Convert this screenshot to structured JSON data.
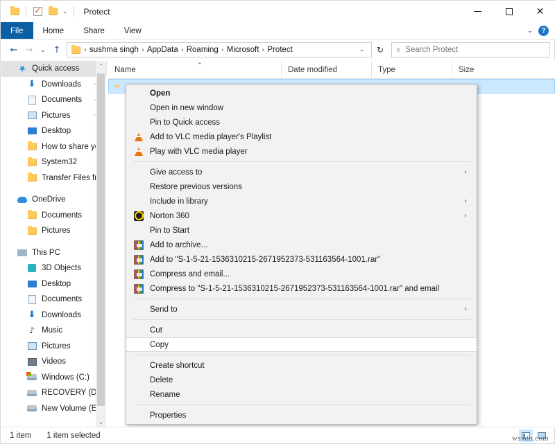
{
  "window": {
    "title": "Protect",
    "minimize_label": "Minimize",
    "maximize_label": "Maximize",
    "close_label": "Close",
    "help_label": "?",
    "ribbon_expand": "⌄"
  },
  "quick_access_toolbar": [
    {
      "name": "properties-folder",
      "icon": "folder-icon"
    },
    {
      "name": "checkbox-toggle",
      "icon": "checkbox-icon"
    },
    {
      "name": "new-folder",
      "icon": "folder-icon"
    },
    {
      "name": "customize-dropdown",
      "icon": "chevron-down-icon",
      "label": "⌄"
    }
  ],
  "ribbon": {
    "tabs": [
      {
        "label": "File",
        "active": true
      },
      {
        "label": "Home",
        "active": false
      },
      {
        "label": "Share",
        "active": false
      },
      {
        "label": "View",
        "active": false
      }
    ]
  },
  "navigation": {
    "back": "←",
    "forward": "→",
    "recent": "⌄",
    "up": "↑",
    "refresh": "↻",
    "breadcrumb": [
      "sushma singh",
      "AppData",
      "Roaming",
      "Microsoft",
      "Protect"
    ],
    "breadcrumb_separator": "›",
    "breadcrumb_caret": "⌄"
  },
  "search": {
    "placeholder": "Search Protect",
    "value": "",
    "icon": "search-icon"
  },
  "sidebar": {
    "groups": [
      {
        "header": {
          "label": "Quick access",
          "icon": "star-icon",
          "selected": true
        },
        "items": [
          {
            "label": "Downloads",
            "icon": "download-icon",
            "pinned": true
          },
          {
            "label": "Documents",
            "icon": "document-icon",
            "pinned": true
          },
          {
            "label": "Pictures",
            "icon": "picture-icon",
            "pinned": true
          },
          {
            "label": "Desktop",
            "icon": "desktop-icon",
            "pinned": false
          },
          {
            "label": "How to share yo",
            "icon": "folder-icon",
            "pinned": false
          },
          {
            "label": "System32",
            "icon": "folder-icon",
            "pinned": false
          },
          {
            "label": "Transfer Files fro",
            "icon": "folder-icon",
            "pinned": false
          }
        ]
      },
      {
        "header": {
          "label": "OneDrive",
          "icon": "cloud-icon",
          "selected": false
        },
        "items": [
          {
            "label": "Documents",
            "icon": "folder-icon",
            "pinned": false
          },
          {
            "label": "Pictures",
            "icon": "folder-icon",
            "pinned": false
          }
        ]
      },
      {
        "header": {
          "label": "This PC",
          "icon": "pc-icon",
          "selected": false
        },
        "items": [
          {
            "label": "3D Objects",
            "icon": "3d-objects-icon",
            "pinned": false
          },
          {
            "label": "Desktop",
            "icon": "desktop-icon",
            "pinned": false
          },
          {
            "label": "Documents",
            "icon": "document-icon",
            "pinned": false
          },
          {
            "label": "Downloads",
            "icon": "download-icon",
            "pinned": false
          },
          {
            "label": "Music",
            "icon": "music-icon",
            "pinned": false
          },
          {
            "label": "Pictures",
            "icon": "picture-icon",
            "pinned": false
          },
          {
            "label": "Videos",
            "icon": "video-icon",
            "pinned": false
          },
          {
            "label": "Windows (C:)",
            "icon": "windows-drive-icon",
            "pinned": false
          },
          {
            "label": "RECOVERY (D:)",
            "icon": "drive-icon",
            "pinned": false
          },
          {
            "label": "New Volume (E:)",
            "icon": "drive-icon",
            "pinned": false
          }
        ]
      }
    ],
    "scroll_up": "⌃",
    "scroll_down": "⌄"
  },
  "columns": [
    {
      "label": "Name",
      "sorted": true,
      "sort_caret": "⌃"
    },
    {
      "label": "Date modified",
      "sorted": false
    },
    {
      "label": "Type",
      "sorted": false
    },
    {
      "label": "Size",
      "sorted": false
    }
  ],
  "file_rows": [
    {
      "name": "",
      "icon": "folder-icon",
      "selected": true
    }
  ],
  "context_menu": {
    "items": [
      {
        "label": "Open",
        "icon": null,
        "bold": true,
        "submenu": false,
        "separator_after": false
      },
      {
        "label": "Open in new window",
        "icon": null,
        "bold": false,
        "submenu": false,
        "separator_after": false
      },
      {
        "label": "Pin to Quick access",
        "icon": null,
        "bold": false,
        "submenu": false,
        "separator_after": false
      },
      {
        "label": "Add to VLC media player's Playlist",
        "icon": "vlc-icon",
        "bold": false,
        "submenu": false,
        "separator_after": false
      },
      {
        "label": "Play with VLC media player",
        "icon": "vlc-icon",
        "bold": false,
        "submenu": false,
        "separator_after": true
      },
      {
        "label": "Give access to",
        "icon": null,
        "bold": false,
        "submenu": true,
        "separator_after": false
      },
      {
        "label": "Restore previous versions",
        "icon": null,
        "bold": false,
        "submenu": false,
        "separator_after": false
      },
      {
        "label": "Include in library",
        "icon": null,
        "bold": false,
        "submenu": true,
        "separator_after": false
      },
      {
        "label": "Norton 360",
        "icon": "norton-icon",
        "bold": false,
        "submenu": true,
        "separator_after": false
      },
      {
        "label": "Pin to Start",
        "icon": null,
        "bold": false,
        "submenu": false,
        "separator_after": false
      },
      {
        "label": "Add to archive...",
        "icon": "winrar-icon",
        "bold": false,
        "submenu": false,
        "separator_after": false
      },
      {
        "label": "Add to \"S-1-5-21-1536310215-2671952373-531163564-1001.rar\"",
        "icon": "winrar-icon",
        "bold": false,
        "submenu": false,
        "separator_after": false
      },
      {
        "label": "Compress and email...",
        "icon": "winrar-icon",
        "bold": false,
        "submenu": false,
        "separator_after": false
      },
      {
        "label": "Compress to \"S-1-5-21-1536310215-2671952373-531163564-1001.rar\" and email",
        "icon": "winrar-icon",
        "bold": false,
        "submenu": false,
        "separator_after": true
      },
      {
        "label": "Send to",
        "icon": null,
        "bold": false,
        "submenu": true,
        "separator_after": true
      },
      {
        "label": "Cut",
        "icon": null,
        "bold": false,
        "submenu": false,
        "separator_after": false
      },
      {
        "label": "Copy",
        "icon": null,
        "bold": false,
        "submenu": false,
        "hovered": true,
        "separator_after": true
      },
      {
        "label": "Create shortcut",
        "icon": null,
        "bold": false,
        "submenu": false,
        "separator_after": false
      },
      {
        "label": "Delete",
        "icon": null,
        "bold": false,
        "submenu": false,
        "separator_after": false
      },
      {
        "label": "Rename",
        "icon": null,
        "bold": false,
        "submenu": false,
        "separator_after": true
      },
      {
        "label": "Properties",
        "icon": null,
        "bold": false,
        "submenu": false,
        "separator_after": false
      }
    ],
    "submenu_arrow": "›"
  },
  "status_bar": {
    "item_count": "1 item",
    "selection": "1 item selected",
    "view_details": "details-view-icon",
    "view_thumbnails": "thumbnail-view-icon",
    "watermark": "wsxdn.com"
  },
  "colors": {
    "accent": "#0b5fa4",
    "selection": "#cce8ff",
    "menu_bg": "#f2f2f2",
    "help_blue": "#1c76c7"
  }
}
